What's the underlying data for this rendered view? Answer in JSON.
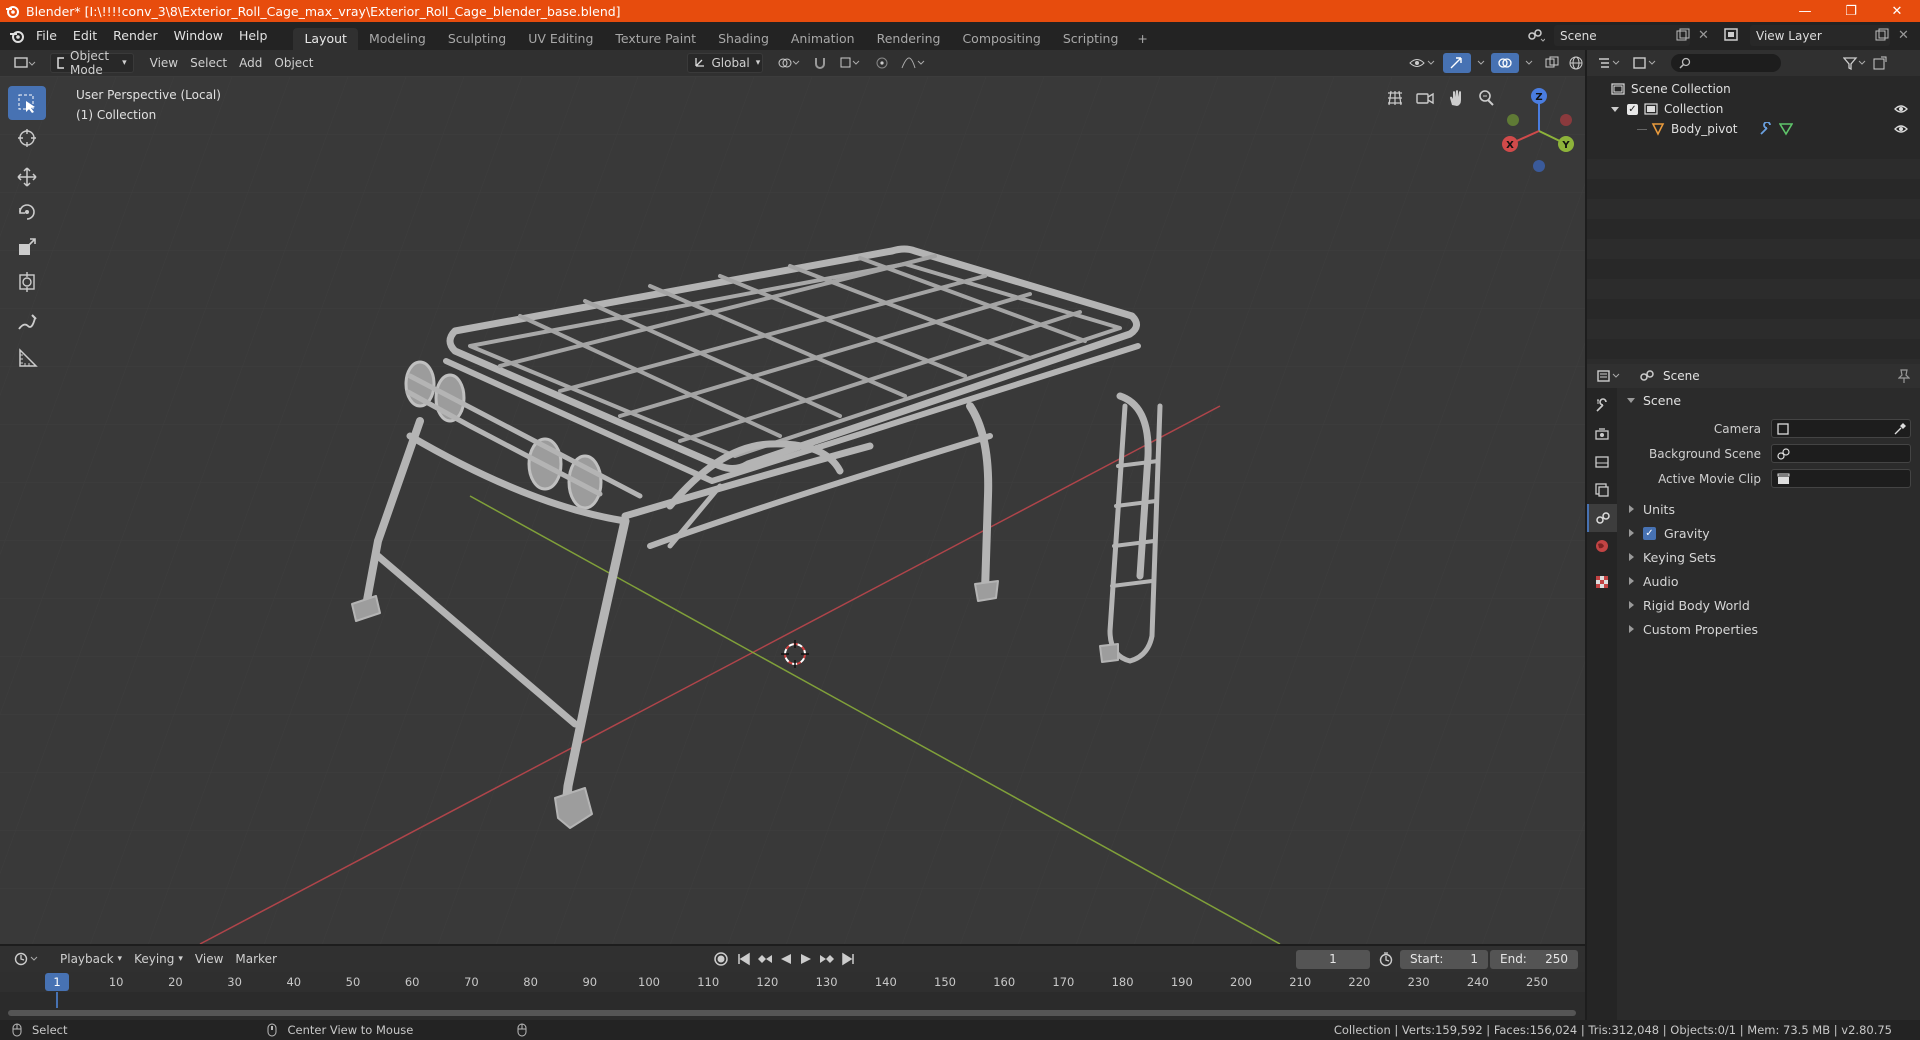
{
  "window": {
    "title": "Blender* [I:\\!!!!conv_3\\8\\Exterior_Roll_Cage_max_vray\\Exterior_Roll_Cage_blender_base.blend]",
    "minimize": "—",
    "maximize": "❐",
    "close": "✕"
  },
  "menubar": {
    "items": [
      "File",
      "Edit",
      "Render",
      "Window",
      "Help"
    ],
    "workspaces": [
      "Layout",
      "Modeling",
      "Sculpting",
      "UV Editing",
      "Texture Paint",
      "Shading",
      "Animation",
      "Rendering",
      "Compositing",
      "Scripting"
    ],
    "active_workspace": "Layout",
    "add_tab": "+",
    "scene": "Scene",
    "view_layer": "View Layer"
  },
  "viewport_header": {
    "mode": "Object Mode",
    "menus": [
      "View",
      "Select",
      "Add",
      "Object"
    ],
    "orientation": "Global"
  },
  "viewport": {
    "perspective": "User Perspective (Local)",
    "collection": "(1) Collection",
    "gizmo": {
      "x": "X",
      "y": "Y",
      "z": "Z"
    }
  },
  "outliner": {
    "root": "Scene Collection",
    "collection": "Collection",
    "object": "Body_pivot"
  },
  "properties": {
    "header_title": "Scene",
    "panel": "Scene",
    "fields": [
      {
        "label": "Camera"
      },
      {
        "label": "Background Scene"
      },
      {
        "label": "Active Movie Clip"
      }
    ],
    "subpanels": [
      "Units",
      "Gravity",
      "Keying Sets",
      "Audio",
      "Rigid Body World",
      "Custom Properties"
    ]
  },
  "timeline": {
    "menus": [
      "Playback",
      "Keying",
      "View",
      "Marker"
    ],
    "current_frame": "1",
    "start_label": "Start:",
    "start": "1",
    "end_label": "End:",
    "end": "250",
    "ticks": [
      "10",
      "20",
      "30",
      "40",
      "50",
      "60",
      "70",
      "80",
      "90",
      "100",
      "110",
      "120",
      "130",
      "140",
      "150",
      "160",
      "170",
      "180",
      "190",
      "200",
      "210",
      "220",
      "230",
      "240",
      "250"
    ]
  },
  "statusbar": {
    "left": "Select",
    "middle": "Center View to Mouse",
    "right": "Collection | Verts:159,592 | Faces:156,024 | Tris:312,048 | Objects:0/1 | Mem: 73.5 MB | v2.80.75"
  },
  "colors": {
    "titlebar": "#e74c0d",
    "accent": "#4772b3",
    "viewport_bg": "#393939",
    "axis_x": "#c4474d",
    "axis_y": "#8db33a"
  }
}
